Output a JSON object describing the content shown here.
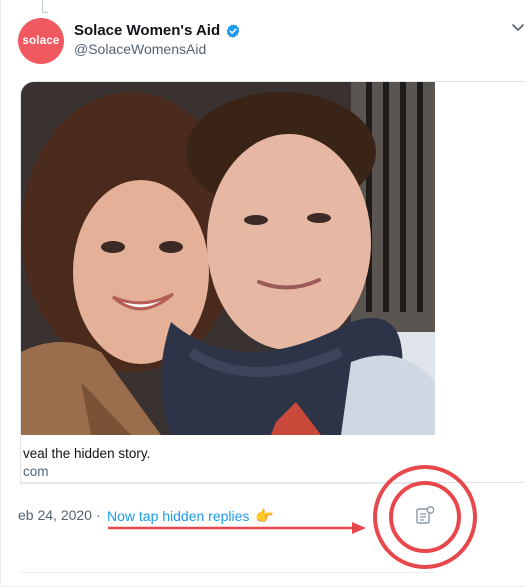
{
  "account": {
    "avatar_text": "solace",
    "display_name": "Solace Women's Aid",
    "handle": "@SolaceWomensAid",
    "verified": true
  },
  "card": {
    "headline": "veal the hidden story.",
    "domain": "com"
  },
  "tweet_meta": {
    "timestamp": "eb 24, 2020 ·"
  },
  "annotation": {
    "text": "Now tap hidden replies",
    "emoji": "👉"
  },
  "icons": {
    "verified": "verified-badge-icon",
    "more": "chevron-down-icon",
    "hidden_replies": "hidden-replies-icon"
  },
  "colors": {
    "brand": "#f0595f",
    "link": "#1d9bf0",
    "annotation_red": "#e8484c",
    "verified_blue": "#1d9bf0"
  }
}
